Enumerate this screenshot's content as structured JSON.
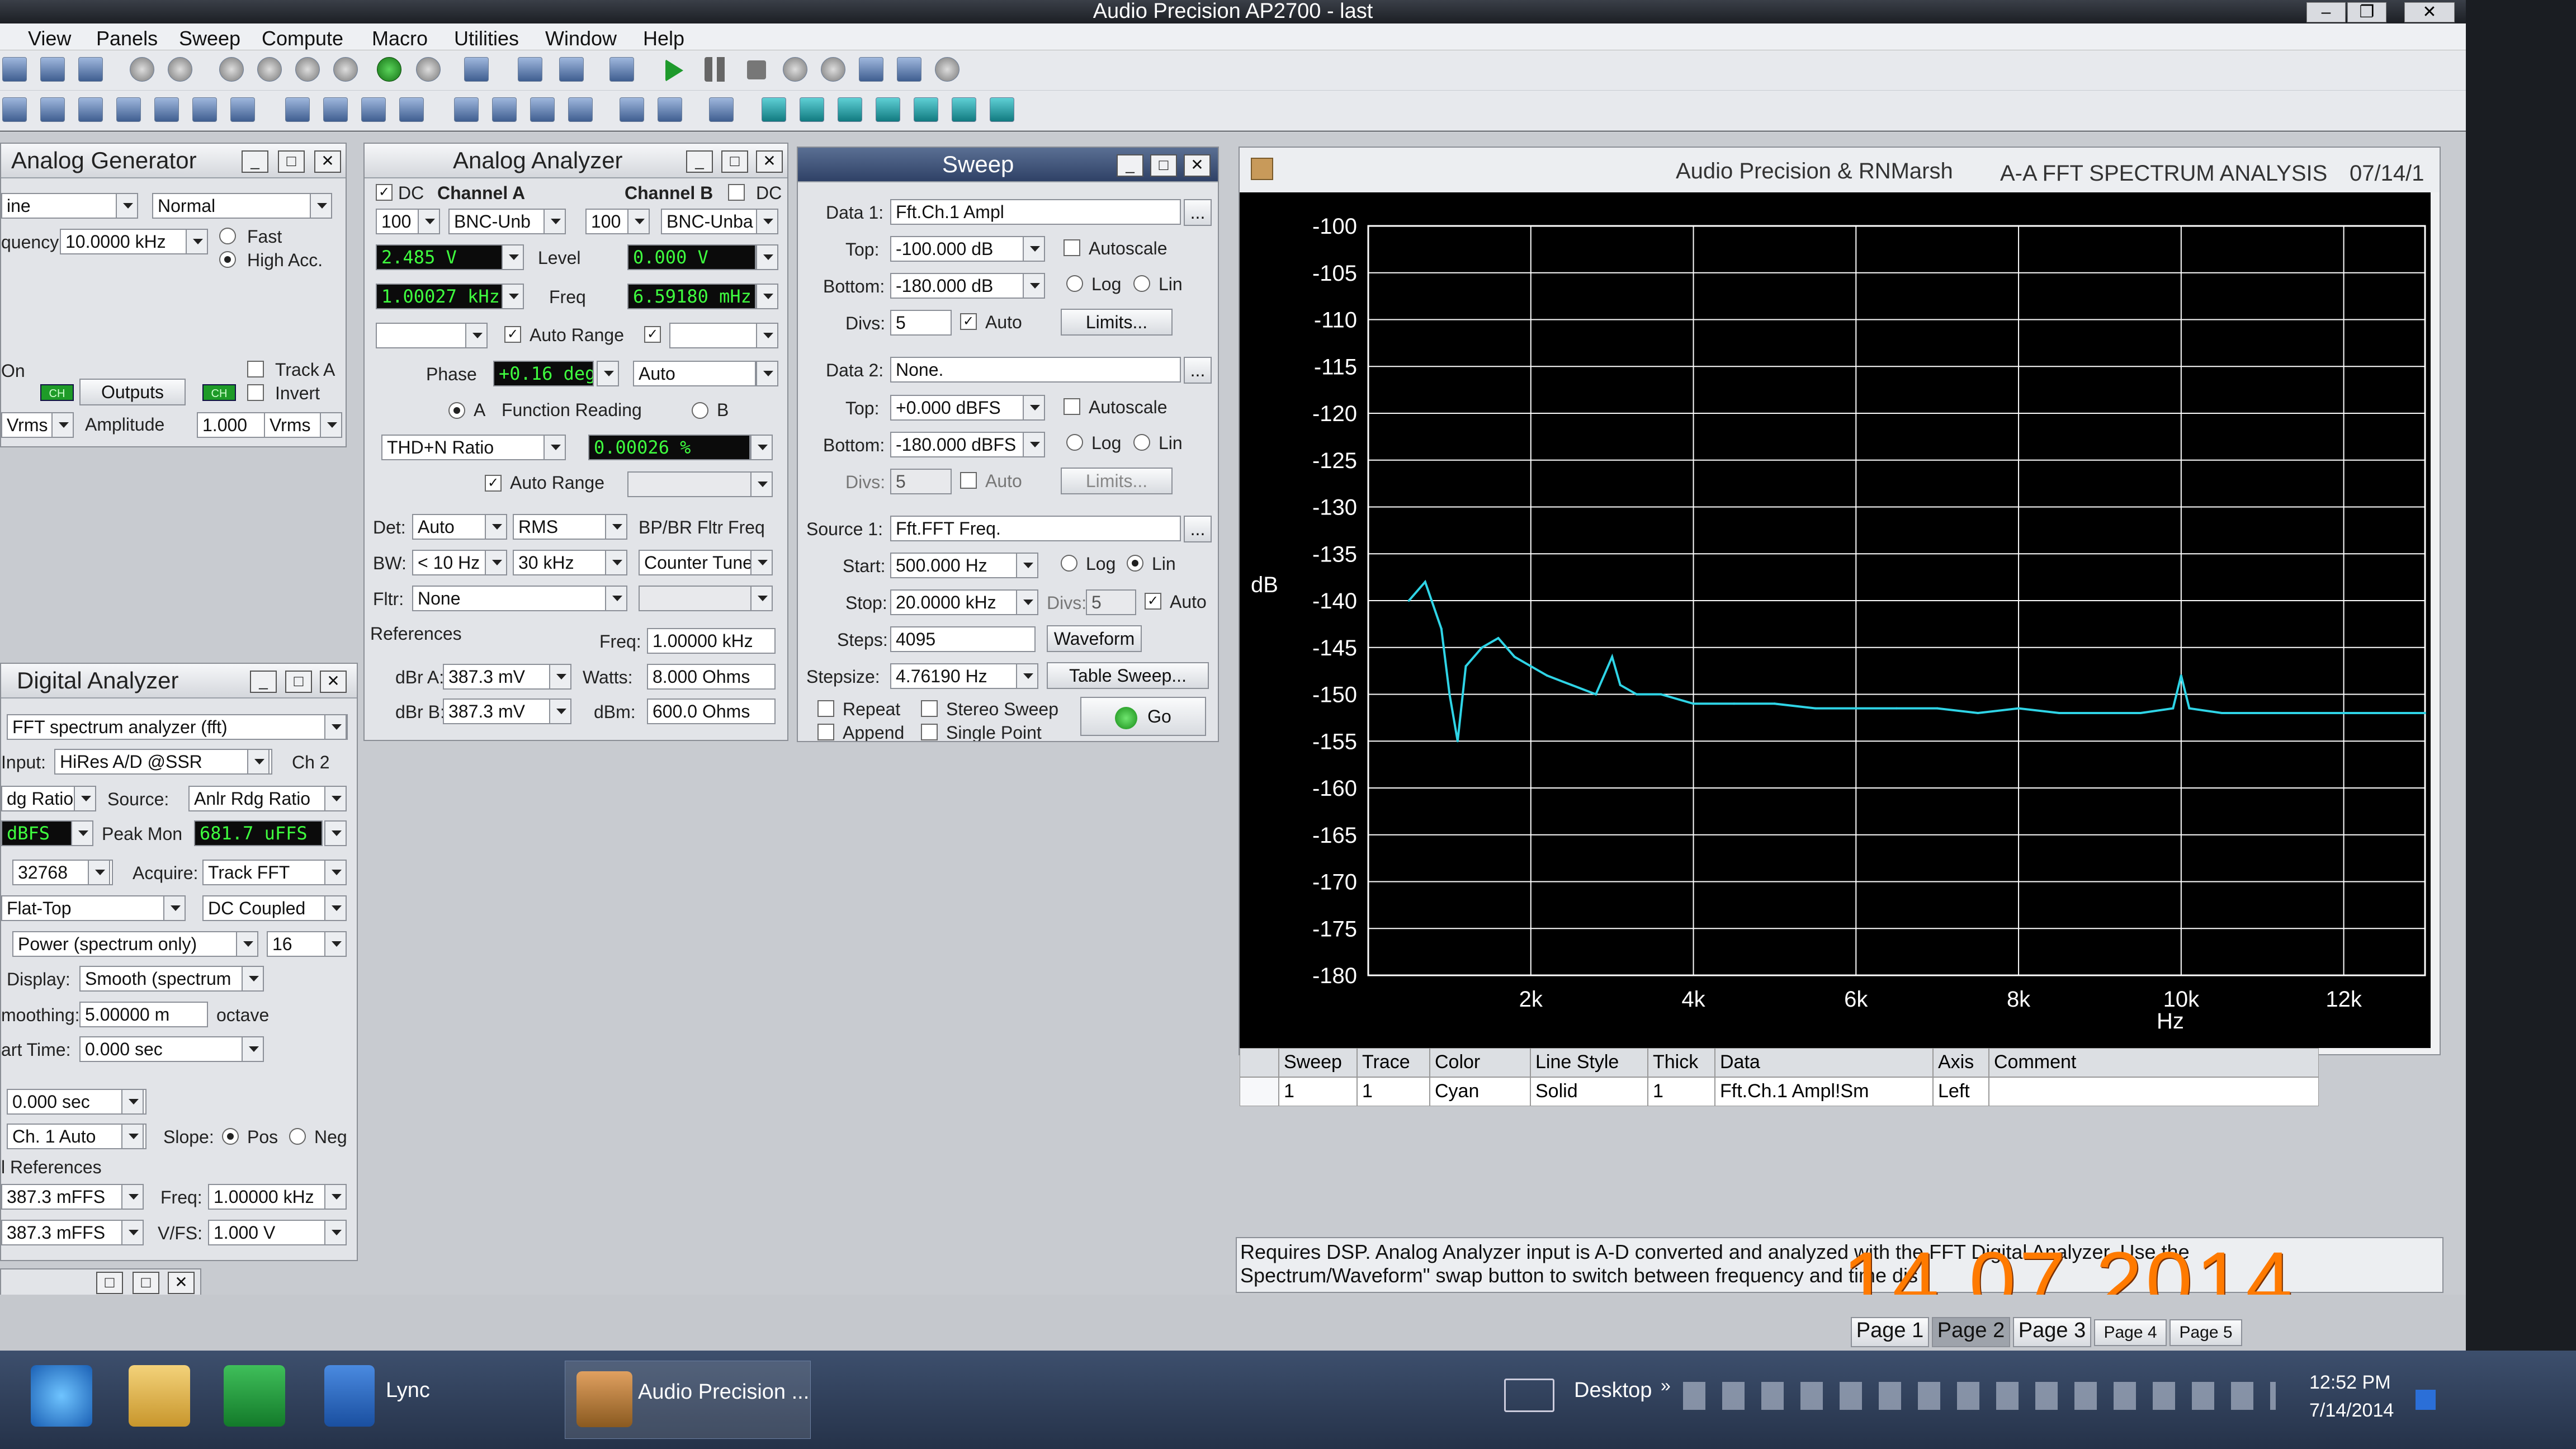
{
  "app": {
    "title": "Audio Precision AP2700 - last"
  },
  "menu": [
    "View",
    "Panels",
    "Sweep",
    "Compute",
    "Macro",
    "Utilities",
    "Window",
    "Help"
  ],
  "analog_generator": {
    "title": "Analog Generator",
    "wave": "ine",
    "mode": "Normal",
    "frequency_label": "quency:",
    "frequency": "10.0000 kHz",
    "fast": "Fast",
    "high_acc": "High Acc.",
    "on_label": "On",
    "outputs_label": "Outputs",
    "track_a": "Track A",
    "invert": "Invert",
    "amp_unit": "Vrms",
    "amplitude_label": "Amplitude",
    "amplitude": "1.000",
    "amplitude_unit": "Vrms"
  },
  "analog_analyzer": {
    "title": "Analog Analyzer",
    "dc_a": "DC",
    "channel_a": "Channel A",
    "channel_b": "Channel B",
    "dc_b": "DC",
    "range_a": "100",
    "input_a": "BNC-Unb",
    "range_b": "100",
    "input_b": "BNC-Unba",
    "level_a": "2.485 V",
    "level_label": "Level",
    "level_b": "0.000 V",
    "freq_a": "1.00027 kHz",
    "freq_label": "Freq",
    "freq_b": "6.59180 mHz",
    "auto_range": "Auto Range",
    "phase_label": "Phase",
    "phase": "+0.16 deg",
    "phase_mode": "Auto",
    "func_a": "A",
    "function_reading": "Function Reading",
    "func_b": "B",
    "func_type": "THD+N Ratio",
    "func_value": "0.00026 %",
    "auto_range2": "Auto Range",
    "det_label": "Det:",
    "det": "Auto",
    "det_mode": "RMS",
    "bp_label": "BP/BR Fltr Freq",
    "bw_label": "BW:",
    "bw_low": "< 10 Hz",
    "bw_high": "30 kHz",
    "counter": "Counter Tune",
    "fltr_label": "Fltr:",
    "fltr": "None",
    "references": "References",
    "ref_freq_label": "Freq:",
    "ref_freq": "1.00000 kHz",
    "dbra_label": "dBr A:",
    "dbra": "387.3 mV",
    "watts_label": "Watts:",
    "watts": "8.000 Ohms",
    "dbrb_label": "dBr B:",
    "dbrb": "387.3 mV",
    "dbm_label": "dBm:",
    "dbm": "600.0 Ohms"
  },
  "sweep": {
    "title": "Sweep",
    "data1_label": "Data 1:",
    "data1": "Fft.Ch.1 Ampl",
    "top_label": "Top:",
    "top1": "-100.000 dB",
    "autoscale": "Autoscale",
    "bottom_label": "Bottom:",
    "bottom1": "-180.000 dB",
    "log": "Log",
    "lin": "Lin",
    "divs_label": "Divs:",
    "divs1": "5",
    "auto": "Auto",
    "limits": "Limits...",
    "data2_label": "Data 2:",
    "data2": "None.",
    "top2": "+0.000 dBFS",
    "bottom2": "-180.000 dBFS",
    "divs2": "5",
    "source_label": "Source 1:",
    "source1": "Fft.FFT Freq.",
    "start_label": "Start:",
    "start": "500.000 Hz",
    "stop_label": "Stop:",
    "stop": "20.0000 kHz",
    "divs3_label": "Divs:",
    "divs3": "5",
    "steps_label": "Steps:",
    "steps": "4095",
    "waveform": "Waveform",
    "stepsize_label": "Stepsize:",
    "stepsize": "4.76190 Hz",
    "table_sweep": "Table Sweep...",
    "repeat": "Repeat",
    "stereo": "Stereo Sweep",
    "append": "Append",
    "single_point": "Single Point",
    "go": "Go"
  },
  "digital_analyzer": {
    "title": "Digital Analyzer",
    "mode": "FFT spectrum analyzer (fft)",
    "input_label": "Input:",
    "input": "HiRes A/D @SSR",
    "ch": "Ch 2",
    "ratio": "dg Ratio",
    "source_label": "Source:",
    "source": "Anlr Rdg Ratio",
    "level": "dBFS",
    "peakmon_label": "Peak Mon",
    "peakmon": "681.7 uFFS",
    "fft_size": "32768",
    "acquire_label": "Acquire:",
    "acquire": "Track FFT",
    "window": "Flat-Top",
    "coupling": "DC Coupled",
    "power": "Power (spectrum only)",
    "averages": "16",
    "display_label": "Display:",
    "display": "Smooth (spectrum",
    "smoothing_label": "moothing:",
    "smoothing": "5.00000 m",
    "octave": "octave",
    "start_time_label": "art Time:",
    "start_time": "0.000 sec",
    "delay": "0.000 sec",
    "trigger": "Ch. 1 Auto",
    "slope_label": "Slope:",
    "pos": "Pos",
    "neg": "Neg",
    "refs_label": "l References",
    "ref1": "387.3 mFFS",
    "freq_label": "Freq:",
    "freq": "1.00000 kHz",
    "ref2": "387.3 mFFS",
    "vfs_label": "V/FS:",
    "vfs": "1.000 V"
  },
  "graph": {
    "header_left": "Audio Precision & RNMarsh",
    "header_title": "A-A FFT SPECTRUM ANALYSIS",
    "header_date": "07/14/1",
    "ylabel": "dB",
    "xlabel": "Hz",
    "colors": {
      "trace": "#2fd4e6",
      "grid": "#ffffff",
      "background": "#000000"
    }
  },
  "chart_data": {
    "type": "line",
    "xlim": [
      0,
      13000
    ],
    "ylim": [
      -180,
      -100
    ],
    "yticks": [
      -100,
      -105,
      -110,
      -115,
      -120,
      -125,
      -130,
      -135,
      -140,
      -145,
      -150,
      -155,
      -160,
      -165,
      -170,
      -175,
      -180
    ],
    "xticks": [
      2000,
      4000,
      6000,
      8000,
      10000,
      12000
    ],
    "xtick_labels": [
      "2k",
      "4k",
      "6k",
      "8k",
      "10k",
      "12k"
    ],
    "x": [
      500,
      700,
      900,
      1000,
      1100,
      1200,
      1400,
      1600,
      1800,
      2000,
      2200,
      2500,
      2800,
      3000,
      3100,
      3300,
      3600,
      4000,
      4500,
      5000,
      5500,
      6000,
      6500,
      7000,
      7500,
      8000,
      8500,
      9000,
      9500,
      9900,
      10000,
      10100,
      10500,
      11000,
      11500,
      12000,
      12500,
      13000
    ],
    "y": [
      -140,
      -138,
      -143,
      -150,
      -155,
      -147,
      -145,
      -144,
      -146,
      -147,
      -148,
      -149,
      -150,
      -146,
      -149,
      -150,
      -150,
      -151,
      -151,
      -151,
      -151.5,
      -151.5,
      -151.5,
      -151.5,
      -152,
      -151.5,
      -152,
      -152,
      -152,
      -151.5,
      -148,
      -151.5,
      -152,
      -152,
      -152,
      -152,
      -152,
      -152
    ],
    "grid": true
  },
  "trace_table": {
    "headers": [
      "Sweep",
      "Trace",
      "Color",
      "Line Style",
      "Thick",
      "Data",
      "Axis",
      "Comment"
    ],
    "row": [
      "1",
      "1",
      "Cyan",
      "Solid",
      "1",
      "Fft.Ch.1 Ampl!Sm",
      "Left",
      ""
    ]
  },
  "status": {
    "line1": "Requires DSP.  Analog Analyzer input is A-D converted and analyzed with the FFT Digital Analyzer. Use the",
    "line2": "Spectrum/Waveform\" swap button to switch between frequency and time dis"
  },
  "pages": [
    "Page 1",
    "Page 2",
    "Page 3",
    "Page 4",
    "Page 5"
  ],
  "datestamp": "14 07 2014",
  "taskbar": {
    "lync": "Lync",
    "ap": "Audio Precision ...",
    "desktop": "Desktop",
    "time": "12:52 PM",
    "date": "7/14/2014"
  }
}
